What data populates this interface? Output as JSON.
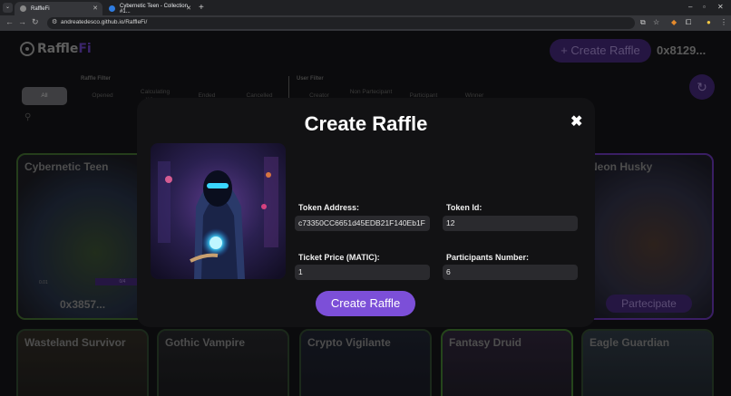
{
  "browser": {
    "tabs": [
      {
        "title": "RaffleFi"
      },
      {
        "title": "Cybernetic Teen - Collection #1..."
      }
    ],
    "url": "andreatedesco.github.io/RaffleFi/"
  },
  "header": {
    "logo": "Raffle",
    "logo_suffix": "Fi",
    "create_button": "+ Create Raffle",
    "wallet": "0x8129..."
  },
  "filters": {
    "raffle_filter_label": "Raffle Filter",
    "user_filter_label": "User Filter",
    "all": "All",
    "raffle": [
      "Opened",
      "Calculating Winner",
      "Ended",
      "Cancelled"
    ],
    "user": [
      "Creator",
      "Non Partecipant",
      "Participant",
      "Winner"
    ]
  },
  "cards_top": [
    {
      "title": "Cybernetic Teen",
      "price": "0.01",
      "count": "0/4",
      "owner": "0x3857..."
    },
    {
      "title": "Neon Husky",
      "button": "Partecipate"
    }
  ],
  "cards_bottom": [
    {
      "title": "Wasteland Survivor"
    },
    {
      "title": "Gothic Vampire"
    },
    {
      "title": "Crypto Vigilante"
    },
    {
      "title": "Fantasy Druid"
    },
    {
      "title": "Eagle Guardian"
    }
  ],
  "modal": {
    "title": "Create Raffle",
    "close": "✖",
    "token_address_label": "Token Address:",
    "token_address": "c73350CC6651d45EDB21F140Eb1F",
    "token_id_label": "Token Id:",
    "token_id": "12",
    "ticket_price_label": "Ticket Price (MATIC):",
    "ticket_price": "1",
    "participants_label": "Participants Number:",
    "participants": "6",
    "submit": "Create Raffle"
  },
  "colors": {
    "accent": "#7c4fd8",
    "accent_dim": "#3a2266"
  },
  "icons": [
    "search-icon",
    "refresh-icon",
    "close-icon",
    "lock-icon",
    "star-icon",
    "extensions-icon",
    "menu-icon"
  ]
}
